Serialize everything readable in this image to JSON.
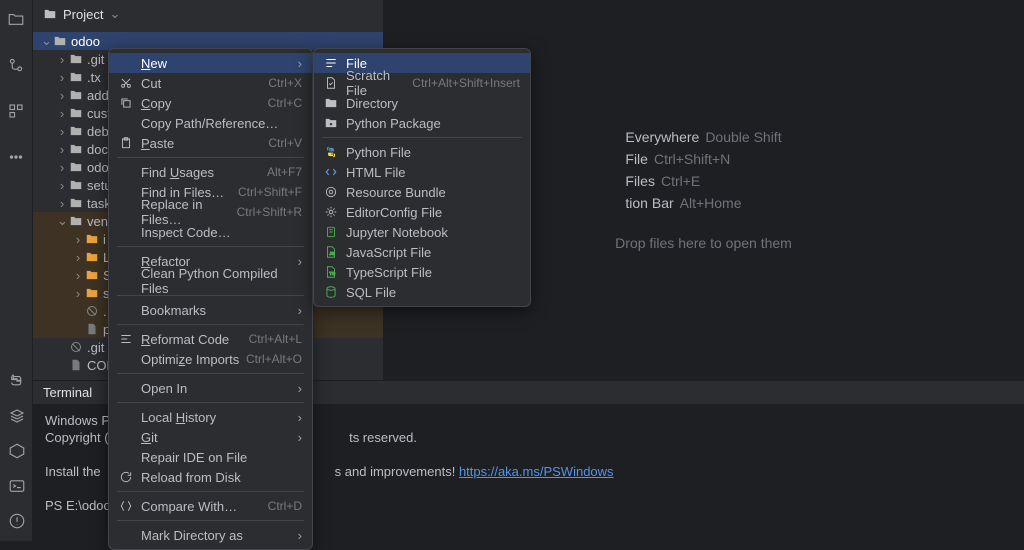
{
  "header": {
    "project_label": "Project"
  },
  "tree": {
    "root": "odoo",
    "items": [
      {
        "name": ".git",
        "kind": "folder",
        "depth": 1
      },
      {
        "name": ".tx",
        "kind": "folder",
        "depth": 1
      },
      {
        "name": "add",
        "kind": "folder",
        "depth": 1
      },
      {
        "name": "cust",
        "kind": "folder",
        "depth": 1
      },
      {
        "name": "deb",
        "kind": "folder",
        "depth": 1
      },
      {
        "name": "doc",
        "kind": "folder",
        "depth": 1
      },
      {
        "name": "odo",
        "kind": "folder",
        "depth": 1
      },
      {
        "name": "setu",
        "kind": "folder",
        "depth": 1
      },
      {
        "name": "task",
        "kind": "folder",
        "depth": 1
      },
      {
        "name": "ven",
        "kind": "folder",
        "depth": 1,
        "venv": true,
        "expanded": true
      },
      {
        "name": "i",
        "kind": "folder",
        "depth": 2,
        "venv": true,
        "orange": true
      },
      {
        "name": "L",
        "kind": "folder",
        "depth": 2,
        "venv": true,
        "orange": true
      },
      {
        "name": "S",
        "kind": "folder",
        "depth": 2,
        "venv": true,
        "orange": true
      },
      {
        "name": "s",
        "kind": "folder",
        "depth": 2,
        "venv": true,
        "orange": true
      },
      {
        "name": ".",
        "kind": "ignore",
        "depth": 2,
        "venv": true
      },
      {
        "name": "p",
        "kind": "file",
        "depth": 2,
        "venv": true
      },
      {
        "name": ".git",
        "kind": "ignore",
        "depth": 1
      },
      {
        "name": "CON",
        "kind": "file",
        "depth": 1
      }
    ]
  },
  "welcome": {
    "lines": [
      {
        "k": "Everywhere",
        "s": "Double Shift"
      },
      {
        "k": "File",
        "s": "Ctrl+Shift+N"
      },
      {
        "k": "Files",
        "s": "Ctrl+E"
      },
      {
        "k": "tion Bar",
        "s": "Alt+Home"
      }
    ],
    "drop": "Drop files here to open them"
  },
  "context_menu": [
    {
      "label": "New",
      "shortcut": "",
      "icon": "",
      "arrow": true,
      "hl": true,
      "u": "N"
    },
    {
      "label": "Cut",
      "shortcut": "Ctrl+X",
      "icon": "cut",
      "u": ""
    },
    {
      "label": "Copy",
      "shortcut": "Ctrl+C",
      "icon": "copy",
      "u": "C"
    },
    {
      "label": "Copy Path/Reference…",
      "shortcut": "",
      "icon": ""
    },
    {
      "label": "Paste",
      "shortcut": "Ctrl+V",
      "icon": "paste",
      "u": "P"
    },
    {
      "sep": true
    },
    {
      "label": "Find Usages",
      "shortcut": "Alt+F7",
      "icon": "",
      "u": "U"
    },
    {
      "label": "Find in Files…",
      "shortcut": "Ctrl+Shift+F",
      "icon": ""
    },
    {
      "label": "Replace in Files…",
      "shortcut": "Ctrl+Shift+R",
      "icon": ""
    },
    {
      "label": "Inspect Code…",
      "shortcut": "",
      "icon": ""
    },
    {
      "sep": true
    },
    {
      "label": "Refactor",
      "shortcut": "",
      "icon": "",
      "arrow": true,
      "u": "R"
    },
    {
      "label": "Clean Python Compiled Files",
      "shortcut": "",
      "icon": ""
    },
    {
      "sep": true
    },
    {
      "label": "Bookmarks",
      "shortcut": "",
      "icon": "",
      "arrow": true
    },
    {
      "sep": true
    },
    {
      "label": "Reformat Code",
      "shortcut": "Ctrl+Alt+L",
      "icon": "reformat",
      "u": "R"
    },
    {
      "label": "Optimize Imports",
      "shortcut": "Ctrl+Alt+O",
      "icon": "",
      "u": "z"
    },
    {
      "sep": true
    },
    {
      "label": "Open In",
      "shortcut": "",
      "icon": "",
      "arrow": true
    },
    {
      "sep": true
    },
    {
      "label": "Local History",
      "shortcut": "",
      "icon": "",
      "arrow": true,
      "u": "H"
    },
    {
      "label": "Git",
      "shortcut": "",
      "icon": "",
      "arrow": true,
      "u": "G"
    },
    {
      "label": "Repair IDE on File",
      "shortcut": "",
      "icon": ""
    },
    {
      "label": "Reload from Disk",
      "shortcut": "",
      "icon": "reload"
    },
    {
      "sep": true
    },
    {
      "label": "Compare With…",
      "shortcut": "Ctrl+D",
      "icon": "compare"
    },
    {
      "sep": true
    },
    {
      "label": "Mark Directory as",
      "shortcut": "",
      "icon": "",
      "arrow": true
    }
  ],
  "submenu_new": [
    {
      "label": "File",
      "icon": "file",
      "hl": true
    },
    {
      "label": "Scratch File",
      "icon": "scratch",
      "shortcut": "Ctrl+Alt+Shift+Insert"
    },
    {
      "label": "Directory",
      "icon": "dir"
    },
    {
      "label": "Python Package",
      "icon": "pkg"
    },
    {
      "sep": true
    },
    {
      "label": "Python File",
      "icon": "py"
    },
    {
      "label": "HTML File",
      "icon": "html"
    },
    {
      "label": "Resource Bundle",
      "icon": "bundle"
    },
    {
      "label": "EditorConfig File",
      "icon": "editorconfig"
    },
    {
      "label": "Jupyter Notebook",
      "icon": "jupyter"
    },
    {
      "label": "JavaScript File",
      "icon": "js"
    },
    {
      "label": "TypeScript File",
      "icon": "ts"
    },
    {
      "label": "SQL File",
      "icon": "sql"
    }
  ],
  "terminal": {
    "header": "Terminal",
    "lines": [
      "Windows PowerS",
      "Copyright (",
      "",
      "Install the",
      "",
      "PS E:\\odoo>"
    ],
    "rights": "ts reserved.",
    "install_tail": "s and improvements! ",
    "link": "https://aka.ms/PSWindows"
  }
}
